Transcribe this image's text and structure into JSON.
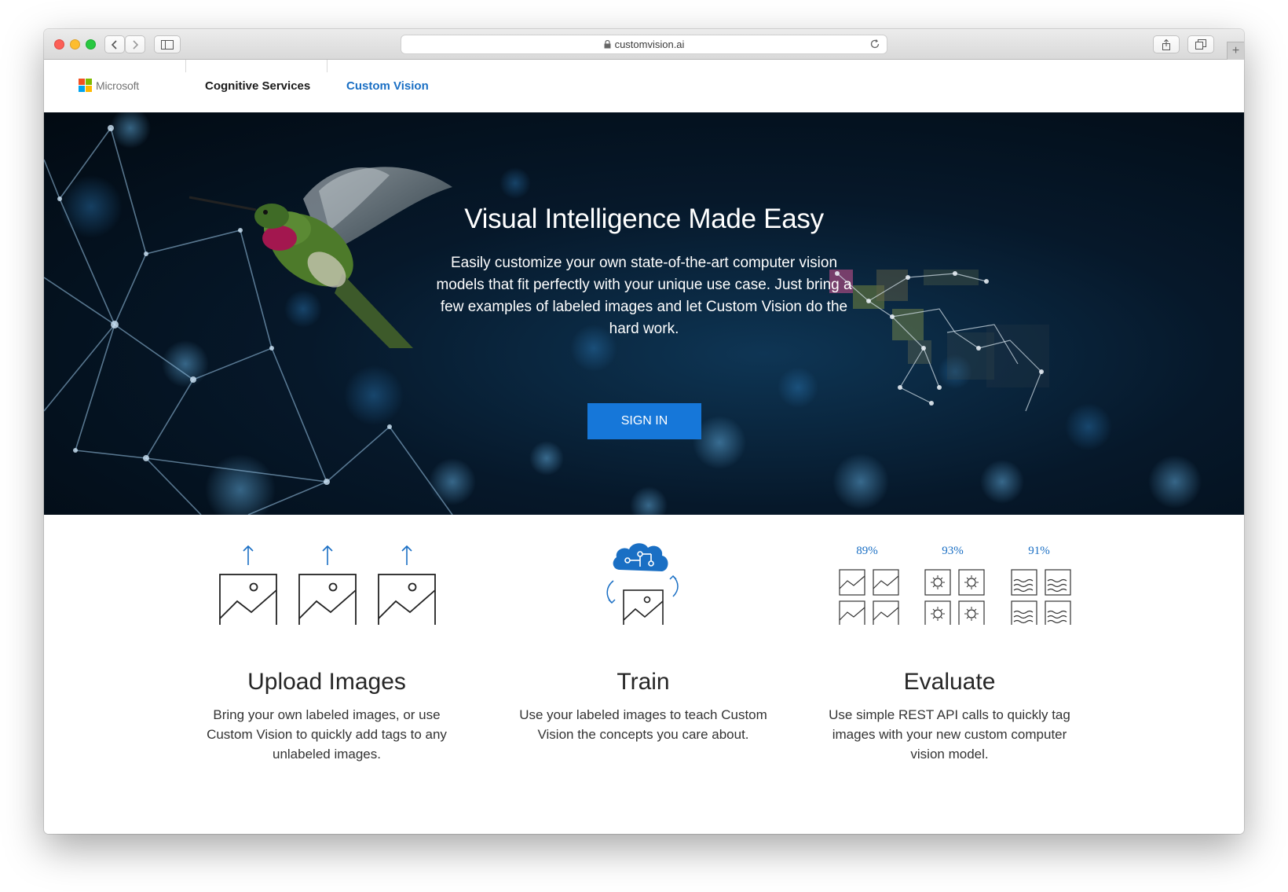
{
  "browser": {
    "url": "customvision.ai"
  },
  "nav": {
    "brand": "Microsoft",
    "links": [
      "Cognitive Services",
      "Custom Vision"
    ]
  },
  "hero": {
    "title": "Visual Intelligence Made Easy",
    "subtitle": "Easily customize your own state-of-the-art computer vision models that fit perfectly with your unique use case. Just bring a few examples of labeled images and let Custom Vision do the hard work.",
    "cta": "SIGN IN"
  },
  "features": [
    {
      "title": "Upload Images",
      "description": "Bring your own labeled images, or use Custom Vision to quickly add tags to any unlabeled images."
    },
    {
      "title": "Train",
      "description": "Use your labeled images to teach Custom Vision the concepts you care about."
    },
    {
      "title": "Evaluate",
      "description": "Use simple REST API calls to quickly tag images with your new custom computer vision model.",
      "scores": [
        "89%",
        "93%",
        "91%"
      ]
    }
  ],
  "colors": {
    "accent": "#1a6fc4",
    "button": "#1677d9",
    "hero_bg": "#06182a"
  },
  "icons": {
    "ms_logo": [
      "#f25022",
      "#7fba00",
      "#00a4ef",
      "#ffb900"
    ]
  }
}
